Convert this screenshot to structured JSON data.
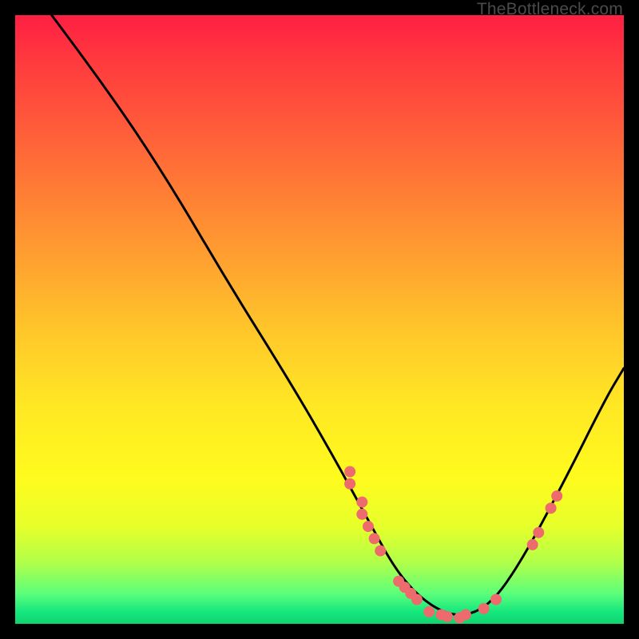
{
  "watermark": "TheBottleneck.com",
  "chart_data": {
    "type": "line",
    "title": "",
    "xlabel": "",
    "ylabel": "",
    "xlim": [
      0,
      100
    ],
    "ylim": [
      0,
      100
    ],
    "curve": [
      {
        "x": 6,
        "y": 100
      },
      {
        "x": 15,
        "y": 88
      },
      {
        "x": 25,
        "y": 73
      },
      {
        "x": 35,
        "y": 56
      },
      {
        "x": 45,
        "y": 40
      },
      {
        "x": 52,
        "y": 28
      },
      {
        "x": 58,
        "y": 17
      },
      {
        "x": 63,
        "y": 8
      },
      {
        "x": 68,
        "y": 3
      },
      {
        "x": 73,
        "y": 1
      },
      {
        "x": 78,
        "y": 3
      },
      {
        "x": 83,
        "y": 10
      },
      {
        "x": 90,
        "y": 23
      },
      {
        "x": 97,
        "y": 37
      },
      {
        "x": 100,
        "y": 42
      }
    ],
    "markers": [
      {
        "x": 55,
        "y": 25
      },
      {
        "x": 55,
        "y": 23
      },
      {
        "x": 57,
        "y": 20
      },
      {
        "x": 57,
        "y": 18
      },
      {
        "x": 58,
        "y": 16
      },
      {
        "x": 59,
        "y": 14
      },
      {
        "x": 60,
        "y": 12
      },
      {
        "x": 63,
        "y": 7
      },
      {
        "x": 64,
        "y": 6
      },
      {
        "x": 65,
        "y": 5
      },
      {
        "x": 66,
        "y": 4
      },
      {
        "x": 68,
        "y": 2
      },
      {
        "x": 70,
        "y": 1.5
      },
      {
        "x": 71,
        "y": 1.2
      },
      {
        "x": 73,
        "y": 1
      },
      {
        "x": 74,
        "y": 1.5
      },
      {
        "x": 77,
        "y": 2.5
      },
      {
        "x": 79,
        "y": 4
      },
      {
        "x": 85,
        "y": 13
      },
      {
        "x": 86,
        "y": 15
      },
      {
        "x": 88,
        "y": 19
      },
      {
        "x": 89,
        "y": 21
      }
    ],
    "marker_color": "#ED6B6C",
    "curve_color": "#000000"
  }
}
